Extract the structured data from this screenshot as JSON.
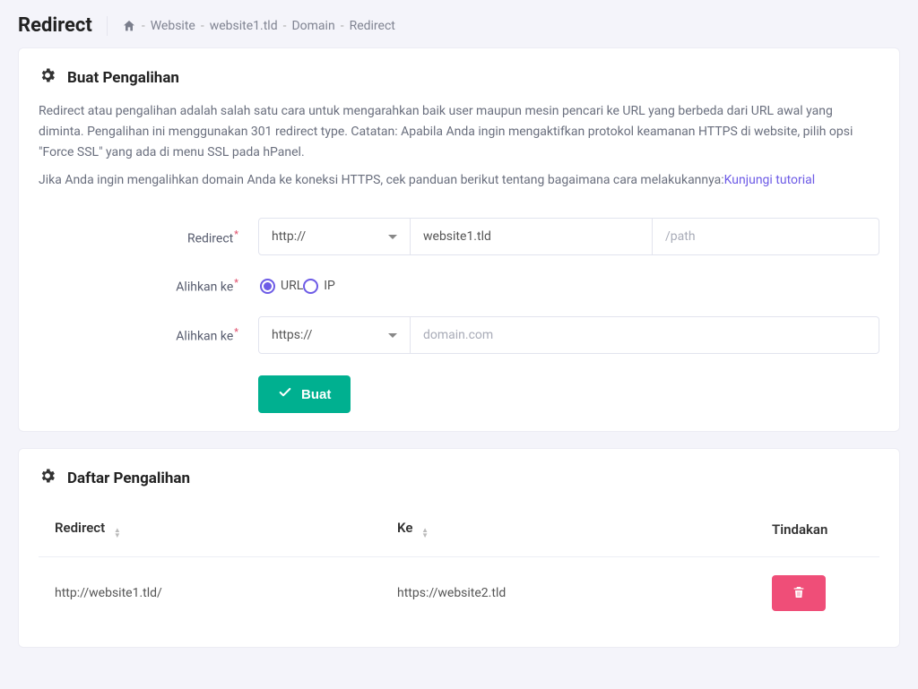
{
  "page_title": "Redirect",
  "breadcrumb": {
    "home_icon": "home-icon",
    "items": [
      "Website",
      "website1.tld",
      "Domain",
      "Redirect"
    ]
  },
  "create_card": {
    "title": "Buat Pengalihan",
    "desc_line1": "Redirect atau pengalihan adalah salah satu cara untuk mengarahkan baik user maupun mesin pencari ke URL yang berbeda dari URL awal yang diminta. Pengalihan ini menggunakan 301 redirect type. Catatan: Apabila Anda ingin mengaktifkan protokol keamanan HTTPS di website, pilih opsi \"Force SSL\" yang ada di menu SSL pada hPanel.",
    "desc_line2_prefix": "Jika Anda ingin mengalihkan domain Anda ke koneksi HTTPS, cek panduan berikut tentang bagaimana cara melakukannya:",
    "desc_line2_link": "Kunjungi tutorial",
    "form": {
      "redirect_label": "Redirect",
      "scheme1_value": "http://",
      "domain_value": "website1.tld",
      "path_placeholder": "/path",
      "redirect_to_label": "Alihkan ke",
      "radio_url": "URL",
      "radio_ip": "IP",
      "scheme2_value": "https://",
      "target_placeholder": "domain.com",
      "create_button": "Buat"
    }
  },
  "list_card": {
    "title": "Daftar Pengalihan",
    "col_redirect": "Redirect",
    "col_to": "Ke",
    "col_action": "Tindakan",
    "rows": [
      {
        "from": "http://website1.tld/",
        "to": "https://website2.tld"
      }
    ]
  }
}
